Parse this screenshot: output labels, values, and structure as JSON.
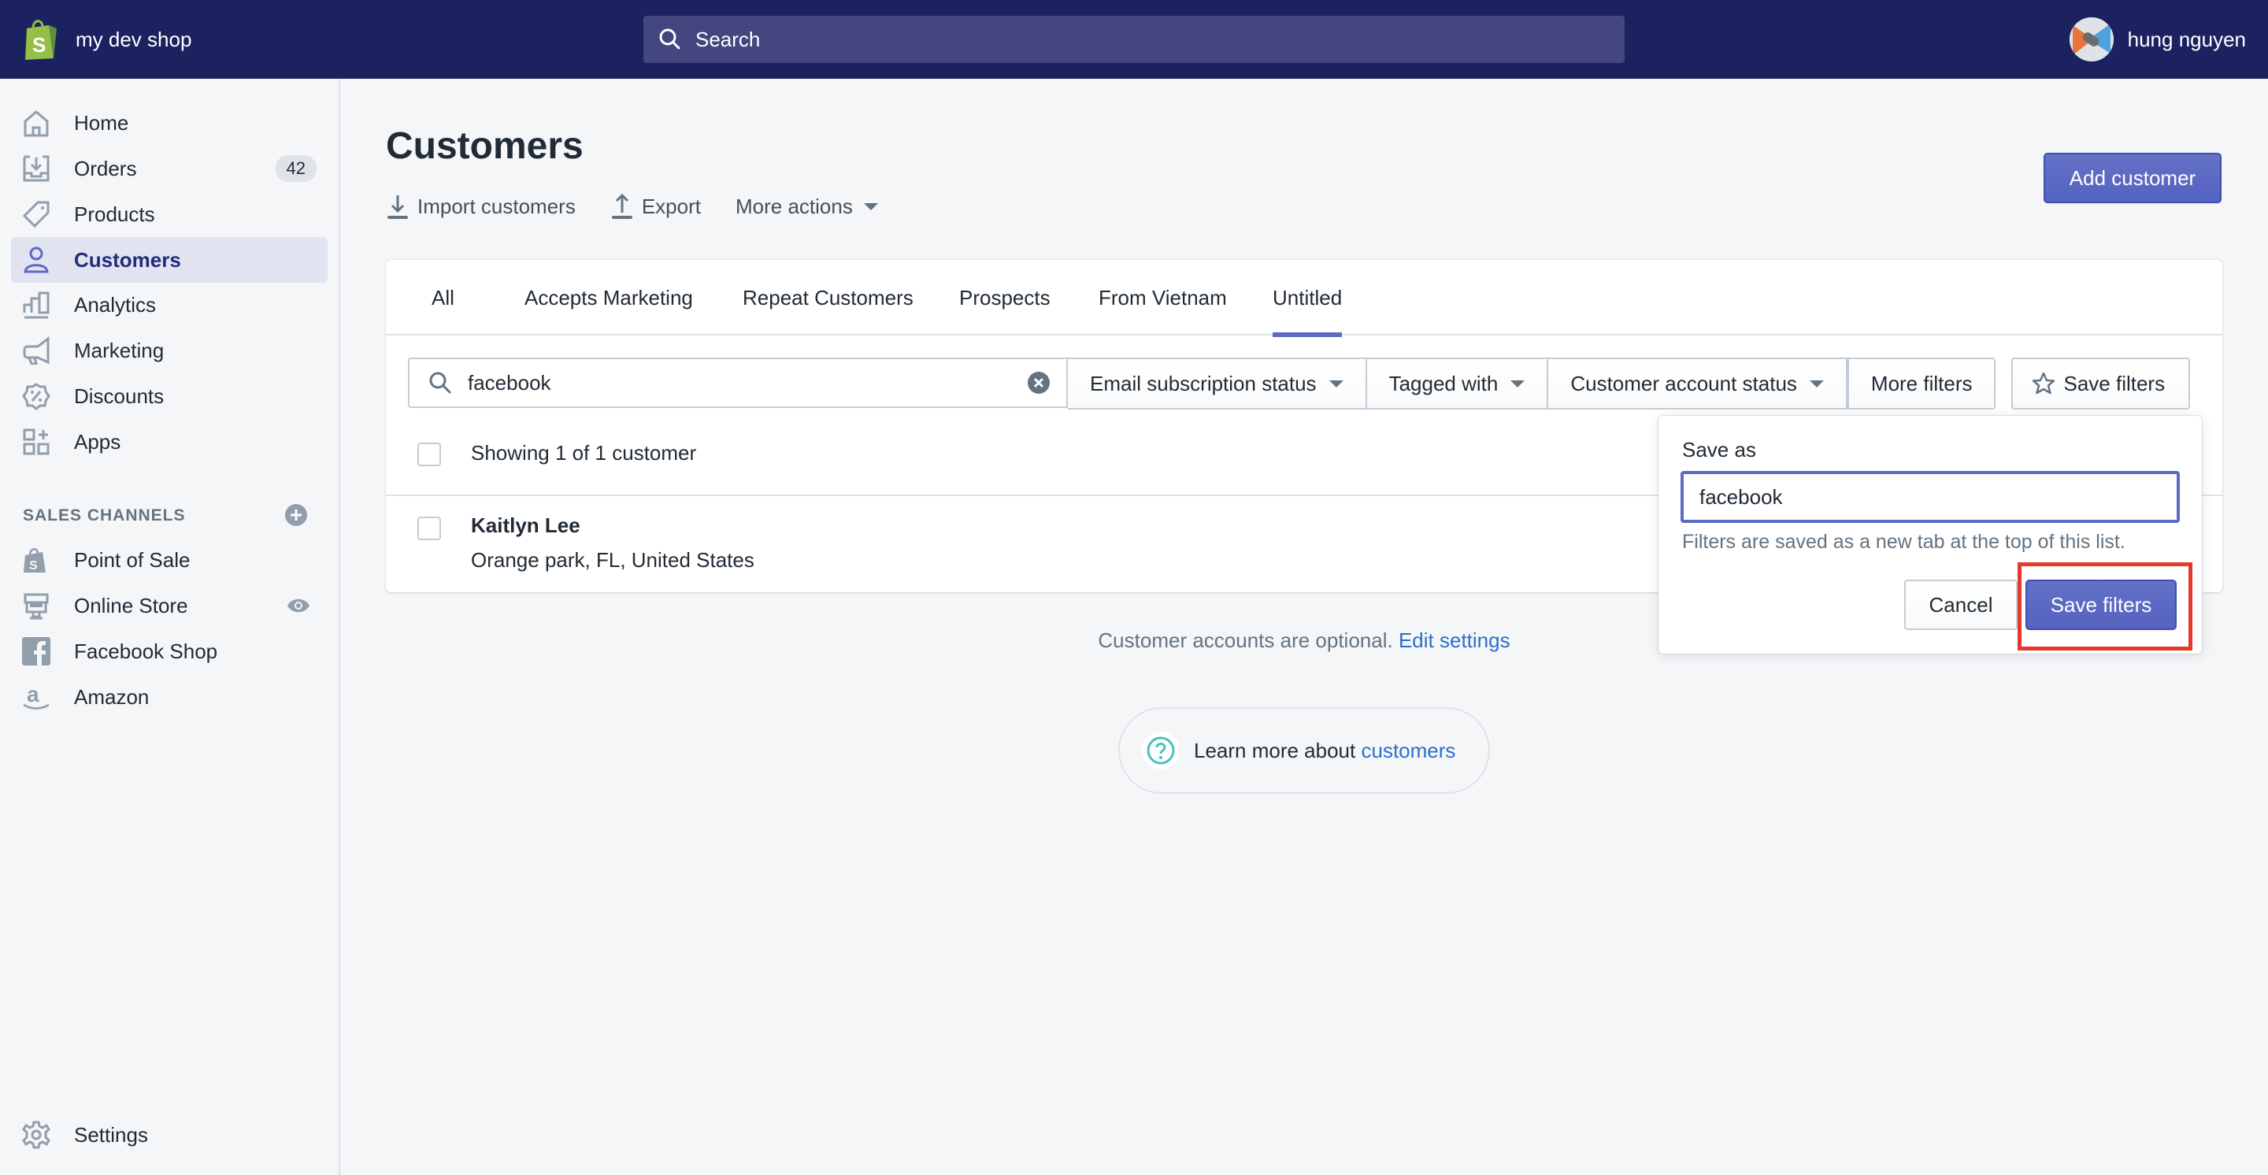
{
  "topbar": {
    "shop_name": "my dev shop",
    "search_placeholder": "Search",
    "user_name": "hung nguyen"
  },
  "sidebar": {
    "items": [
      {
        "label": "Home",
        "icon": "home-icon"
      },
      {
        "label": "Orders",
        "icon": "orders-icon",
        "badge": "42"
      },
      {
        "label": "Products",
        "icon": "tag-icon"
      },
      {
        "label": "Customers",
        "icon": "customer-icon",
        "active": true
      },
      {
        "label": "Analytics",
        "icon": "bar-chart-icon"
      },
      {
        "label": "Marketing",
        "icon": "megaphone-icon"
      },
      {
        "label": "Discounts",
        "icon": "discount-icon"
      },
      {
        "label": "Apps",
        "icon": "apps-icon"
      }
    ],
    "sales_channels_title": "SALES CHANNELS",
    "channels": [
      {
        "label": "Point of Sale",
        "icon": "shopify-bag-icon"
      },
      {
        "label": "Online Store",
        "icon": "store-icon"
      },
      {
        "label": "Facebook Shop",
        "icon": "facebook-icon"
      },
      {
        "label": "Amazon",
        "icon": "amazon-icon"
      }
    ],
    "settings_label": "Settings"
  },
  "page": {
    "title": "Customers",
    "actions": {
      "import": "Import customers",
      "export": "Export",
      "more": "More actions"
    },
    "add_customer": "Add customer"
  },
  "tabs": [
    "All",
    "Accepts Marketing",
    "Repeat Customers",
    "Prospects",
    "From Vietnam",
    "Untitled"
  ],
  "active_tab": "Untitled",
  "filters": {
    "search_value": "facebook",
    "email_subscription": "Email subscription status",
    "tagged_with": "Tagged with",
    "account_status": "Customer account status",
    "more_filters": "More filters",
    "save_filters": "Save filters"
  },
  "list": {
    "showing": "Showing 1 of 1 customer",
    "customers": [
      {
        "name": "Kaitlyn Lee",
        "location": "Orange park, FL, United States"
      }
    ]
  },
  "popover": {
    "label": "Save as",
    "input_value": "facebook",
    "help": "Filters are saved as a new tab at the top of this list.",
    "cancel": "Cancel",
    "save": "Save filters"
  },
  "footer": {
    "accounts_note": "Customer accounts are optional.",
    "edit_settings": "Edit settings",
    "learn_more": "Learn more about",
    "learn_link": "customers"
  },
  "colors": {
    "topbar": "#1c2260",
    "primary": "#5c6ac4",
    "highlight": "#e4392a",
    "link": "#2c6ecb"
  }
}
